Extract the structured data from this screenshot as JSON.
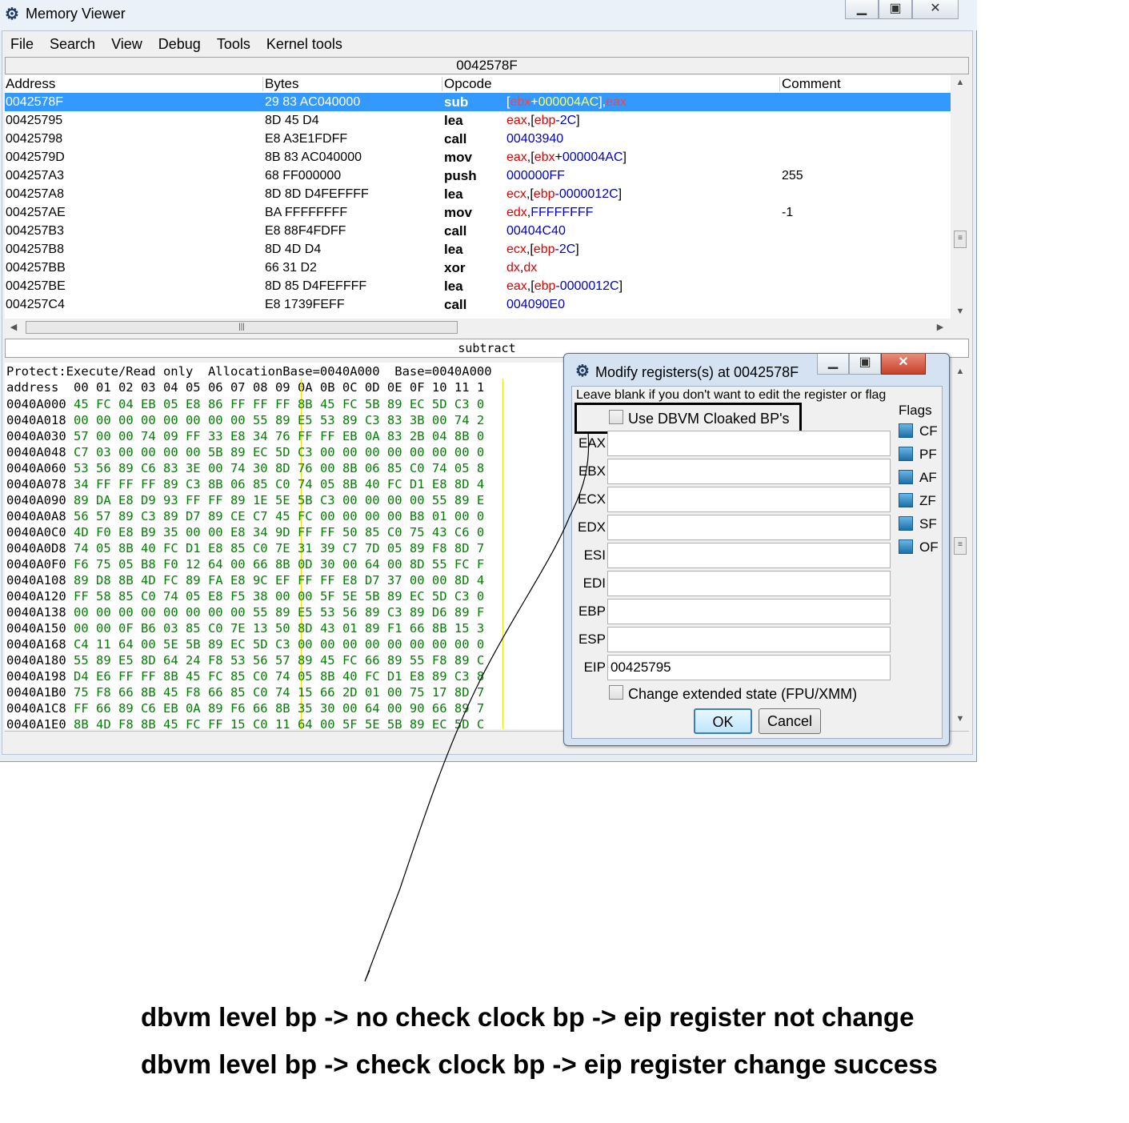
{
  "main_window": {
    "title": "Memory Viewer",
    "menu": [
      "File",
      "Search",
      "View",
      "Debug",
      "Tools",
      "Kernel tools"
    ],
    "address_bar": "0042578F",
    "disasm": {
      "headers": {
        "address": "Address",
        "bytes": "Bytes",
        "opcode": "Opcode",
        "comment": "Comment"
      },
      "rows": [
        {
          "addr": "0042578F",
          "bytes": "29 83 AC040000",
          "op": "sub",
          "args": [
            {
              "t": "[",
              "k": "p"
            },
            {
              "t": "ebx",
              "k": "r"
            },
            {
              "t": "+",
              "k": "p"
            },
            {
              "t": "000004AC",
              "k": "n"
            },
            {
              "t": "],",
              "k": "p"
            },
            {
              "t": "eax",
              "k": "r"
            }
          ],
          "comment": "",
          "selected": true
        },
        {
          "addr": "00425795",
          "bytes": "8D 45 D4",
          "op": "lea",
          "args": [
            {
              "t": "eax",
              "k": "r"
            },
            {
              "t": ",[",
              "k": "p"
            },
            {
              "t": "ebp",
              "k": "r"
            },
            {
              "t": "-2C",
              "k": "n"
            },
            {
              "t": "]",
              "k": "p"
            }
          ],
          "comment": ""
        },
        {
          "addr": "00425798",
          "bytes": "E8 A3E1FDFF",
          "op": "call",
          "args": [
            {
              "t": "00403940",
              "k": "n"
            }
          ],
          "comment": ""
        },
        {
          "addr": "0042579D",
          "bytes": "8B 83 AC040000",
          "op": "mov",
          "args": [
            {
              "t": "eax",
              "k": "r"
            },
            {
              "t": ",[",
              "k": "p"
            },
            {
              "t": "ebx",
              "k": "r"
            },
            {
              "t": "+",
              "k": "p"
            },
            {
              "t": "000004AC",
              "k": "n"
            },
            {
              "t": "]",
              "k": "p"
            }
          ],
          "comment": ""
        },
        {
          "addr": "004257A3",
          "bytes": "68 FF000000",
          "op": "push",
          "args": [
            {
              "t": "000000FF",
              "k": "n"
            }
          ],
          "comment": "255"
        },
        {
          "addr": "004257A8",
          "bytes": "8D 8D D4FEFFFF",
          "op": "lea",
          "args": [
            {
              "t": "ecx",
              "k": "r"
            },
            {
              "t": ",[",
              "k": "p"
            },
            {
              "t": "ebp",
              "k": "r"
            },
            {
              "t": "-0000012C",
              "k": "n"
            },
            {
              "t": "]",
              "k": "p"
            }
          ],
          "comment": ""
        },
        {
          "addr": "004257AE",
          "bytes": "BA FFFFFFFF",
          "op": "mov",
          "args": [
            {
              "t": "edx",
              "k": "r"
            },
            {
              "t": ",",
              "k": "p"
            },
            {
              "t": "FFFFFFFF",
              "k": "n"
            }
          ],
          "comment": "-1"
        },
        {
          "addr": "004257B3",
          "bytes": "E8 88F4FDFF",
          "op": "call",
          "args": [
            {
              "t": "00404C40",
              "k": "n"
            }
          ],
          "comment": ""
        },
        {
          "addr": "004257B8",
          "bytes": "8D 4D D4",
          "op": "lea",
          "args": [
            {
              "t": "ecx",
              "k": "r"
            },
            {
              "t": ",[",
              "k": "p"
            },
            {
              "t": "ebp",
              "k": "r"
            },
            {
              "t": "-2C",
              "k": "n"
            },
            {
              "t": "]",
              "k": "p"
            }
          ],
          "comment": ""
        },
        {
          "addr": "004257BB",
          "bytes": "66 31 D2",
          "op": "xor",
          "args": [
            {
              "t": "dx",
              "k": "r"
            },
            {
              "t": ",",
              "k": "p"
            },
            {
              "t": "dx",
              "k": "r"
            }
          ],
          "comment": ""
        },
        {
          "addr": "004257BE",
          "bytes": "8D 85 D4FEFFFF",
          "op": "lea",
          "args": [
            {
              "t": "eax",
              "k": "r"
            },
            {
              "t": ",[",
              "k": "p"
            },
            {
              "t": "ebp",
              "k": "r"
            },
            {
              "t": "-0000012C",
              "k": "n"
            },
            {
              "t": "]",
              "k": "p"
            }
          ],
          "comment": ""
        },
        {
          "addr": "004257C4",
          "bytes": "E8 1739FEFF",
          "op": "call",
          "args": [
            {
              "t": "004090E0",
              "k": "n"
            }
          ],
          "comment": ""
        }
      ]
    },
    "comment_bar": "subtract",
    "hex": {
      "info": "Protect:Execute/Read only  AllocationBase=0040A000  Base=0040A000",
      "header": "address  00 01 02 03 04 05 06 07 08 09 0A 0B 0C 0D 0E 0F 10 11 1",
      "rows": [
        [
          "0040A000",
          "45 FC 04 EB 05 E8 86 FF FF FF 8B 45 FC 5B 89 EC 5D C3 0"
        ],
        [
          "0040A018",
          "00 00 00 00 00 00 00 00 55 89 E5 53 89 C3 83 3B 00 74 2"
        ],
        [
          "0040A030",
          "57 00 00 74 09 FF 33 E8 34 76 FF FF EB 0A 83 2B 04 8B 0"
        ],
        [
          "0040A048",
          "C7 03 00 00 00 00 5B 89 EC 5D C3 00 00 00 00 00 00 00 0"
        ],
        [
          "0040A060",
          "53 56 89 C6 83 3E 00 74 30 8D 76 00 8B 06 85 C0 74 05 8"
        ],
        [
          "0040A078",
          "34 FF FF FF 89 C3 8B 06 85 C0 74 05 8B 40 FC D1 E8 8D 4"
        ],
        [
          "0040A090",
          "89 DA E8 D9 93 FF FF 89 1E 5E 5B C3 00 00 00 00 55 89 E"
        ],
        [
          "0040A0A8",
          "56 57 89 C3 89 D7 89 CE C7 45 FC 00 00 00 00 B8 01 00 0"
        ],
        [
          "0040A0C0",
          "4D F0 E8 B9 35 00 00 E8 34 9D FF FF 50 85 C0 75 43 C6 0"
        ],
        [
          "0040A0D8",
          "74 05 8B 40 FC D1 E8 85 C0 7E 31 39 C7 7D 05 89 F8 8D 7"
        ],
        [
          "0040A0F0",
          "F6 75 05 B8 F0 12 64 00 66 8B 0D 30 00 64 00 8D 55 FC F"
        ],
        [
          "0040A108",
          "89 D8 8B 4D FC 89 FA E8 9C EF FF FF E8 D7 37 00 00 8D 4"
        ],
        [
          "0040A120",
          "FF 58 85 C0 74 05 E8 F5 38 00 00 5F 5E 5B 89 EC 5D C3 0"
        ],
        [
          "0040A138",
          "00 00 00 00 00 00 00 00 55 89 E5 53 56 89 C3 89 D6 89 F"
        ],
        [
          "0040A150",
          "00 00 0F B6 03 85 C0 7E 13 50 8D 43 01 89 F1 66 8B 15 3"
        ],
        [
          "0040A168",
          "C4 11 64 00 5E 5B 89 EC 5D C3 00 00 00 00 00 00 00 00 0"
        ],
        [
          "0040A180",
          "55 89 E5 8D 64 24 F8 53 56 57 89 45 FC 66 89 55 F8 89 C"
        ],
        [
          "0040A198",
          "D4 E6 FF FF 8B 45 FC 85 C0 74 05 8B 40 FC D1 E8 89 C3 8"
        ],
        [
          "0040A1B0",
          "75 F8 66 8B 45 F8 66 85 C0 74 15 66 2D 01 00 75 17 8D 7"
        ],
        [
          "0040A1C8",
          "FF 66 89 C6 EB 0A 89 F6 66 8B 35 30 00 64 00 90 66 89 7"
        ],
        [
          "0040A1E0",
          "8B 4D F8 8B 45 FC FF 15 C0 11 64 00 5F 5E 5B 89 EC 5D C"
        ]
      ]
    }
  },
  "dialog": {
    "title": "Modify registers(s) at 0042578F",
    "hint": "Leave blank if you don't want to edit the register or flag",
    "dbvm_checkbox": "Use DBVM Cloaked BP's",
    "flags_title": "Flags",
    "flags": [
      "CF",
      "PF",
      "AF",
      "ZF",
      "SF",
      "OF"
    ],
    "registers": [
      {
        "name": "EAX",
        "value": ""
      },
      {
        "name": "EBX",
        "value": ""
      },
      {
        "name": "ECX",
        "value": ""
      },
      {
        "name": "EDX",
        "value": ""
      },
      {
        "name": "ESI",
        "value": ""
      },
      {
        "name": "EDI",
        "value": ""
      },
      {
        "name": "EBP",
        "value": ""
      },
      {
        "name": "ESP",
        "value": ""
      },
      {
        "name": "EIP",
        "value": "00425795"
      }
    ],
    "extended_checkbox": "Change extended state (FPU/XMM)",
    "ok": "OK",
    "cancel": "Cancel"
  },
  "notes": [
    "dbvm level bp -> no check clock bp -> eip register not change",
    "dbvm level bp -> check clock bp -> eip register change success"
  ]
}
